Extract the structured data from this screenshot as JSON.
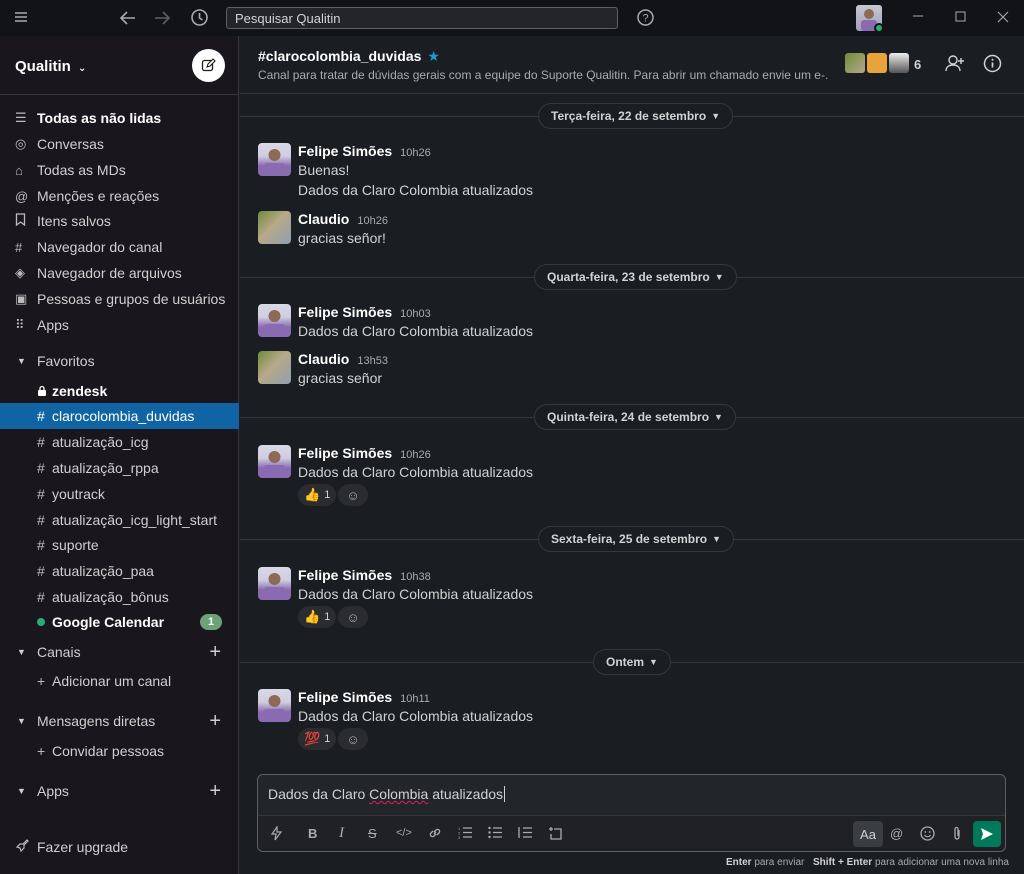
{
  "topbar": {
    "search_text": "Pesquisar Qualitin"
  },
  "sidebar": {
    "workspace": "Qualitin",
    "nav": [
      {
        "label": "Todas as não lidas",
        "icon": "list-icon"
      },
      {
        "label": "Conversas",
        "icon": "threads-icon"
      },
      {
        "label": "Todas as MDs",
        "icon": "dm-icon"
      },
      {
        "label": "Menções e reações",
        "icon": "at-icon"
      },
      {
        "label": "Itens salvos",
        "icon": "bookmark-icon"
      },
      {
        "label": "Navegador do canal",
        "icon": "channel-browser-icon"
      },
      {
        "label": "Navegador de arquivos",
        "icon": "layers-icon"
      },
      {
        "label": "Pessoas e grupos de usuários",
        "icon": "people-icon"
      },
      {
        "label": "Apps",
        "icon": "apps-grid-icon"
      }
    ],
    "favorites_label": "Favoritos",
    "favorites": [
      {
        "label": "zendesk",
        "prefix": "🔒"
      },
      {
        "label": "clarocolombia_duvidas",
        "prefix": "#"
      },
      {
        "label": "atualização_icg",
        "prefix": "#"
      },
      {
        "label": "atualização_rppa",
        "prefix": "#"
      },
      {
        "label": "youtrack",
        "prefix": "#"
      },
      {
        "label": "atualização_icg_light_start",
        "prefix": "#"
      },
      {
        "label": "suporte",
        "prefix": "#"
      },
      {
        "label": "atualização_paa",
        "prefix": "#"
      },
      {
        "label": "atualização_bônus",
        "prefix": "#"
      },
      {
        "label": "Google Calendar",
        "badge": "1"
      }
    ],
    "channels_label": "Canais",
    "add_channel": "Adicionar um canal",
    "dms_label": "Mensagens diretas",
    "invite": "Convidar pessoas",
    "apps_label": "Apps",
    "upgrade": "Fazer upgrade"
  },
  "channel": {
    "name": "#clarocolombia_duvidas",
    "topic": "Canal para tratar de dúvidas gerais com a equipe do Suporte Qualitin. Para abrir um chamado envie um e-...",
    "member_count": "6"
  },
  "days": [
    "Terça-feira, 22 de setembro",
    "Quarta-feira, 23 de setembro",
    "Quinta-feira, 24 de setembro",
    "Sexta-feira, 25 de setembro",
    "Ontem"
  ],
  "messages": [
    {
      "author": "Felipe Simões",
      "time": "10h26",
      "lines": [
        "Buenas!",
        "Dados da Claro Colombia atualizados"
      ]
    },
    {
      "author": "Claudio",
      "time": "10h26",
      "lines": [
        "gracias señor!"
      ]
    },
    {
      "author": "Felipe Simões",
      "time": "10h03",
      "lines": [
        "Dados da Claro Colombia atualizados"
      ]
    },
    {
      "author": "Claudio",
      "time": "13h53",
      "lines": [
        "gracias señor"
      ]
    },
    {
      "author": "Felipe Simões",
      "time": "10h26",
      "lines": [
        "Dados da Claro Colombia atualizados"
      ],
      "reaction": {
        "emoji": "👍",
        "count": "1"
      }
    },
    {
      "author": "Felipe Simões",
      "time": "10h38",
      "lines": [
        "Dados da Claro Colombia atualizados"
      ],
      "reaction": {
        "emoji": "👍",
        "count": "1"
      }
    },
    {
      "author": "Felipe Simões",
      "time": "10h11",
      "lines": [
        "Dados da Claro Colombia atualizados"
      ],
      "reaction": {
        "emoji": "💯",
        "count": "1"
      }
    }
  ],
  "composer": {
    "pre": "Dados da Claro ",
    "misspelled": "Colombia",
    "post": " atualizados",
    "format_button": "Aa"
  },
  "hints": {
    "enter_key": "Enter",
    "enter_text": "para enviar",
    "shift_key": "Shift + Enter",
    "shift_text": "para adicionar uma nova linha"
  },
  "colors": {
    "accent": "#1164a3",
    "send": "#007a5a",
    "online": "#2bac76"
  }
}
